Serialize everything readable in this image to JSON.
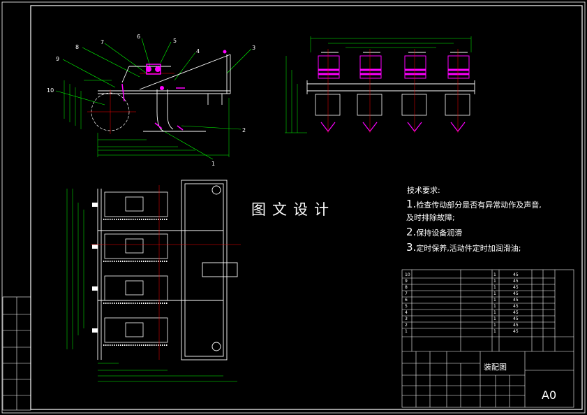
{
  "watermark": "图文设计",
  "tech_requirements": {
    "title": "技术要求:",
    "lines": [
      {
        "num": "1.",
        "text": "检查传动部分是否有异常动作及声音,"
      },
      {
        "num": "",
        "text": "及时排除故障;"
      },
      {
        "num": "2.",
        "text": "保持设备润滑"
      },
      {
        "num": "3.",
        "text": "定时保养,活动件定时加润滑油;"
      }
    ]
  },
  "sheet_size": "A0",
  "drawing_title": "装配图",
  "side_view_labels": [
    "1",
    "2",
    "3",
    "4",
    "5",
    "6",
    "7",
    "8",
    "9",
    "10"
  ],
  "bom_rows": [
    {
      "no": "10",
      "qty": "1",
      "mat": "45"
    },
    {
      "no": "9",
      "qty": "1",
      "mat": "45"
    },
    {
      "no": "8",
      "qty": "1",
      "mat": "45"
    },
    {
      "no": "7",
      "qty": "1",
      "mat": "45"
    },
    {
      "no": "6",
      "qty": "1",
      "mat": "45"
    },
    {
      "no": "5",
      "qty": "1",
      "mat": "45"
    },
    {
      "no": "4",
      "qty": "1",
      "mat": "45"
    },
    {
      "no": "3",
      "qty": "1",
      "mat": "45"
    },
    {
      "no": "2",
      "qty": "1",
      "mat": "45"
    },
    {
      "no": "1",
      "qty": "1",
      "mat": "45"
    }
  ],
  "colors": {
    "outline": "#ffffff",
    "dimension": "#00ff00",
    "part": "#ff00ff",
    "centerline": "#ff0000",
    "leader": "#00ff00"
  }
}
